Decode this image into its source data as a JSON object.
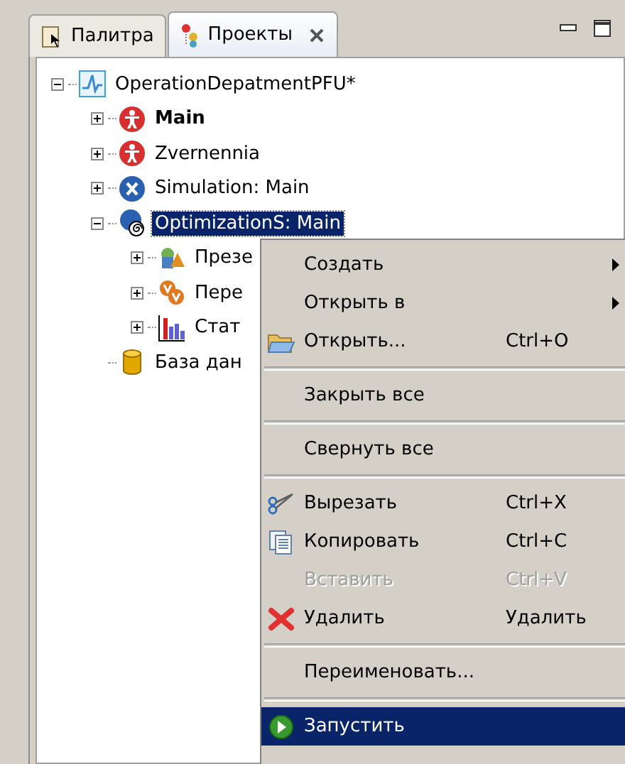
{
  "tabs": [
    {
      "label": "Палитра",
      "kind": "palette",
      "selected": false
    },
    {
      "label": "Проекты",
      "kind": "projects",
      "selected": true
    }
  ],
  "tree": [
    {
      "label": "OperationDepatmentPFU*",
      "kind": "model",
      "expanded": true,
      "bold": false,
      "selected": false,
      "children": [
        {
          "label": "Main",
          "kind": "agent",
          "expanded": false,
          "bold": true,
          "selected": false
        },
        {
          "label": "Zvernennia",
          "kind": "agent",
          "expanded": false,
          "bold": false,
          "selected": false
        },
        {
          "label": "Simulation: Main",
          "kind": "simulation",
          "expanded": false,
          "bold": false,
          "selected": false
        },
        {
          "label": "OptimizationS: Main",
          "kind": "optimization",
          "expanded": true,
          "bold": false,
          "selected": true,
          "children": [
            {
              "label": "Презе",
              "kind": "presentation",
              "expanded": false,
              "bold": false,
              "selected": false
            },
            {
              "label": "Пере",
              "kind": "variables",
              "expanded": false,
              "bold": false,
              "selected": false
            },
            {
              "label": "Стат",
              "kind": "statistics",
              "expanded": false,
              "bold": false,
              "selected": false
            }
          ]
        },
        {
          "label": "База дан",
          "kind": "database",
          "bold": false,
          "selected": false
        }
      ]
    }
  ],
  "context_menu": [
    {
      "kind": "plain",
      "label": "Создать",
      "submenu": true,
      "disabled": false,
      "selected": false
    },
    {
      "kind": "plain",
      "label": "Открыть в",
      "submenu": true,
      "disabled": false,
      "selected": false
    },
    {
      "kind": "folder",
      "label": "Открыть...",
      "shortcut": "Ctrl+O",
      "submenu": false,
      "disabled": false,
      "selected": false
    },
    {
      "kind": "separator"
    },
    {
      "kind": "plain",
      "label": "Закрыть все",
      "submenu": false,
      "disabled": false,
      "selected": false
    },
    {
      "kind": "separator"
    },
    {
      "kind": "plain",
      "label": "Свернуть все",
      "submenu": false,
      "disabled": false,
      "selected": false
    },
    {
      "kind": "separator"
    },
    {
      "kind": "cut",
      "label": "Вырезать",
      "shortcut": "Ctrl+X",
      "submenu": false,
      "disabled": false,
      "selected": false
    },
    {
      "kind": "copy",
      "label": "Копировать",
      "shortcut": "Ctrl+C",
      "submenu": false,
      "disabled": false,
      "selected": false
    },
    {
      "kind": "plain",
      "label": "Вставить",
      "shortcut": "Ctrl+V",
      "submenu": false,
      "disabled": true,
      "selected": false
    },
    {
      "kind": "delete",
      "label": "Удалить",
      "shortcut": "Удалить",
      "submenu": false,
      "disabled": false,
      "selected": false
    },
    {
      "kind": "separator"
    },
    {
      "kind": "plain",
      "label": "Переименовать...",
      "submenu": false,
      "disabled": false,
      "selected": false
    },
    {
      "kind": "separator"
    },
    {
      "kind": "run",
      "label": "Запустить",
      "submenu": false,
      "disabled": false,
      "selected": true
    }
  ]
}
